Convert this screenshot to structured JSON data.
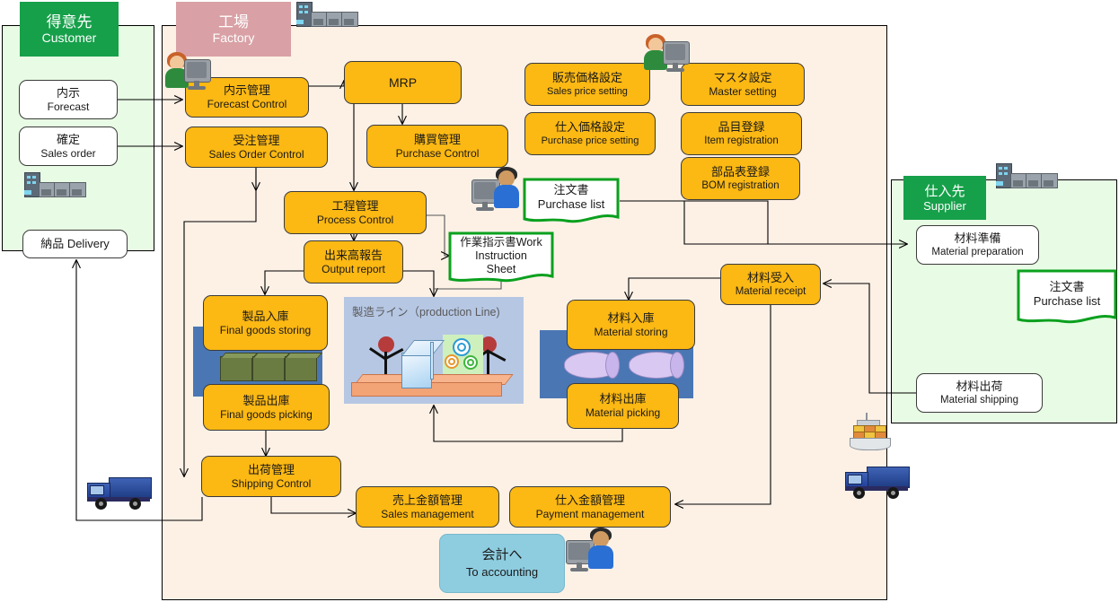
{
  "diagram": {
    "title": "Production management system flow",
    "colors": {
      "orange_node": "#fcb813",
      "green_zone_header": "#16a04a",
      "pink_zone_header": "#d9a0a5",
      "customer_zone_bg": "#e8fbe4",
      "factory_zone_bg": "#fdf1e6",
      "supplier_zone_bg": "#e8fbe4",
      "accounting_node": "#8ecde0",
      "document_border": "#0aa01e",
      "rack_blue": "#4a77b4",
      "production_line_bg": "#b6c7e4"
    }
  },
  "zones": {
    "customer": {
      "jp": "得意先",
      "en": "Customer"
    },
    "factory": {
      "jp": "工場",
      "en": "Factory"
    },
    "supplier": {
      "jp": "仕入先",
      "en": "Supplier"
    }
  },
  "customer_nodes": [
    {
      "jp": "内示",
      "en": "Forecast"
    },
    {
      "jp": "確定",
      "en": "Sales order"
    },
    {
      "jp": "納品 Delivery",
      "en": ""
    }
  ],
  "factory_nodes": [
    {
      "jp": "内示管理",
      "en": "Forecast Control"
    },
    {
      "jp": "受注管理",
      "en": "Sales Order Control"
    },
    {
      "jp": "",
      "en": "MRP"
    },
    {
      "jp": "購買管理",
      "en": "Purchase Control"
    },
    {
      "jp": "工程管理",
      "en": "Process Control"
    },
    {
      "jp": "出来高報告",
      "en": "Output report"
    },
    {
      "jp": "販売価格設定",
      "en": "Sales price setting"
    },
    {
      "jp": "仕入価格設定",
      "en": "Purchase price setting"
    },
    {
      "jp": "マスタ設定",
      "en": "Master setting"
    },
    {
      "jp": "品目登録",
      "en": "Item registration"
    },
    {
      "jp": "部品表登録",
      "en": "BOM registration"
    },
    {
      "jp": "製品入庫",
      "en": "Final goods storing"
    },
    {
      "jp": "製品出庫",
      "en": "Final goods picking"
    },
    {
      "jp": "出荷管理",
      "en": "Shipping Control"
    },
    {
      "jp": "材料受入",
      "en": "Material receipt"
    },
    {
      "jp": "材料入庫",
      "en": "Material storing"
    },
    {
      "jp": "材料出庫",
      "en": "Material  picking"
    },
    {
      "jp": "売上金額管理",
      "en": "Sales management"
    },
    {
      "jp": "仕入金額管理",
      "en": "Payment management"
    },
    {
      "jp": "会計へ",
      "en": "To accounting"
    }
  ],
  "supplier_nodes": [
    {
      "jp": "材料準備",
      "en": "Material preparation"
    },
    {
      "jp": "材料出荷",
      "en": "Material shipping"
    }
  ],
  "documents": [
    {
      "jp": "注文書",
      "en": "Purchase list",
      "where": "factory"
    },
    {
      "jp": "作業指示書Work",
      "en": "Instruction",
      "en2": "Sheet",
      "where": "factory"
    },
    {
      "jp": "注文書",
      "en": "Purchase list",
      "where": "supplier"
    }
  ],
  "production_line": {
    "caption": "製造ライン（production  Line)"
  },
  "icons": [
    {
      "name": "factory-clipart-top",
      "label": "factory"
    },
    {
      "name": "factory-clipart-customer",
      "label": "factory"
    },
    {
      "name": "factory-clipart-supplier",
      "label": "factory"
    },
    {
      "name": "person-at-computer-forecast",
      "label": "operator"
    },
    {
      "name": "person-at-computer-master",
      "label": "operator"
    },
    {
      "name": "person-at-computer-purchase",
      "label": "operator"
    },
    {
      "name": "person-at-computer-accounting",
      "label": "operator"
    },
    {
      "name": "truck-delivery",
      "label": "truck"
    },
    {
      "name": "truck-supply",
      "label": "truck"
    },
    {
      "name": "cargo-ship",
      "label": "ship"
    }
  ]
}
